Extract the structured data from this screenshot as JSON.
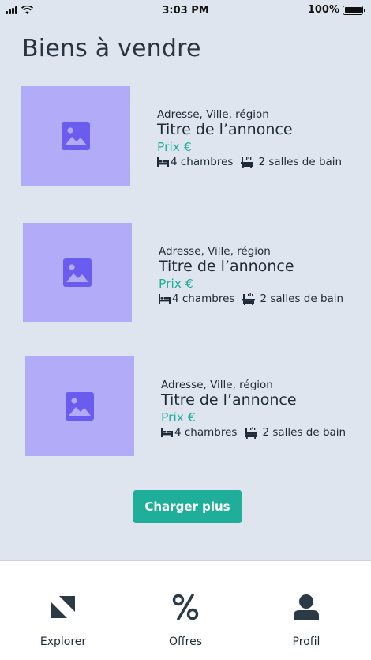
{
  "status_bar": {
    "time": "3:03 PM",
    "battery": "100%"
  },
  "page": {
    "title": "Biens à vendre"
  },
  "listings": [
    {
      "address": "Adresse, Ville, région",
      "title": "Titre de l’annonce",
      "price": "Prix €",
      "bedrooms": "4 chambres",
      "bathrooms": "2 salles de bain"
    },
    {
      "address": "Adresse, Ville, région",
      "title": "Titre de l’annonce",
      "price": "Prix €",
      "bedrooms": "4 chambres",
      "bathrooms": "2 salles de bain"
    },
    {
      "address": "Adresse, Ville, région",
      "title": "Titre de l’annonce",
      "price": "Prix €",
      "bedrooms": "4 chambres",
      "bathrooms": "2 salles de bain"
    }
  ],
  "load_more_label": "Charger plus",
  "tab_bar": {
    "tabs": [
      {
        "label": "Explorer",
        "icon": "explore-icon"
      },
      {
        "label": "Offres",
        "icon": "percent-icon"
      },
      {
        "label": "Profil",
        "icon": "user-icon"
      }
    ]
  },
  "colors": {
    "accent": "#1fae99",
    "placeholder": "#b2acf8",
    "placeholder_icon": "#6b5cf0",
    "background": "#dfe5ee"
  }
}
